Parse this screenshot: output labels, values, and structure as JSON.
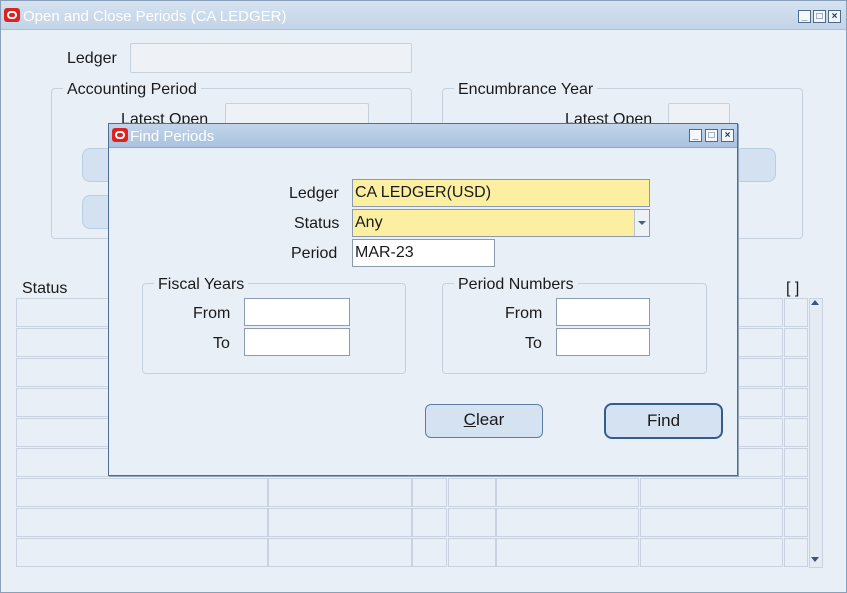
{
  "main": {
    "title": "Open and Close Periods (CA LEDGER)",
    "ledger_label": "Ledger",
    "ledger_value": "",
    "accounting_period_group": "Accounting Period",
    "latest_open_label": "Latest Open",
    "encumbrance_year_group": "Encumbrance Year",
    "enc_latest_open_label": "Latest Open",
    "status_header": "Status",
    "bracket_header": "[ ]"
  },
  "dialog": {
    "title": "Find Periods",
    "ledger_label": "Ledger",
    "ledger_value": "CA LEDGER(USD)",
    "status_label": "Status",
    "status_value": "Any",
    "period_label": "Period",
    "period_value": "MAR-23",
    "fiscal_years_group": "Fiscal Years",
    "fy_from_label": "From",
    "fy_from_value": "",
    "fy_to_label": "To",
    "fy_to_value": "",
    "period_numbers_group": "Period Numbers",
    "pn_from_label": "From",
    "pn_from_value": "",
    "pn_to_label": "To",
    "pn_to_value": "",
    "clear_button_label": "Clear",
    "clear_mnemonic": "C",
    "clear_rest": "lear",
    "find_button_label": "Find"
  },
  "icons": {
    "app_logo": "oracle-logo-icon",
    "minimize": "minimize-icon",
    "maximize": "maximize-icon",
    "close": "close-icon",
    "dropdown": "chevron-down-icon",
    "scroll_up": "scroll-up-arrow-icon",
    "scroll_down": "scroll-down-arrow-icon"
  },
  "colors": {
    "required_field": "#fcefa1",
    "window_bg": "#e9eff7",
    "logo_red": "#dd2222"
  }
}
